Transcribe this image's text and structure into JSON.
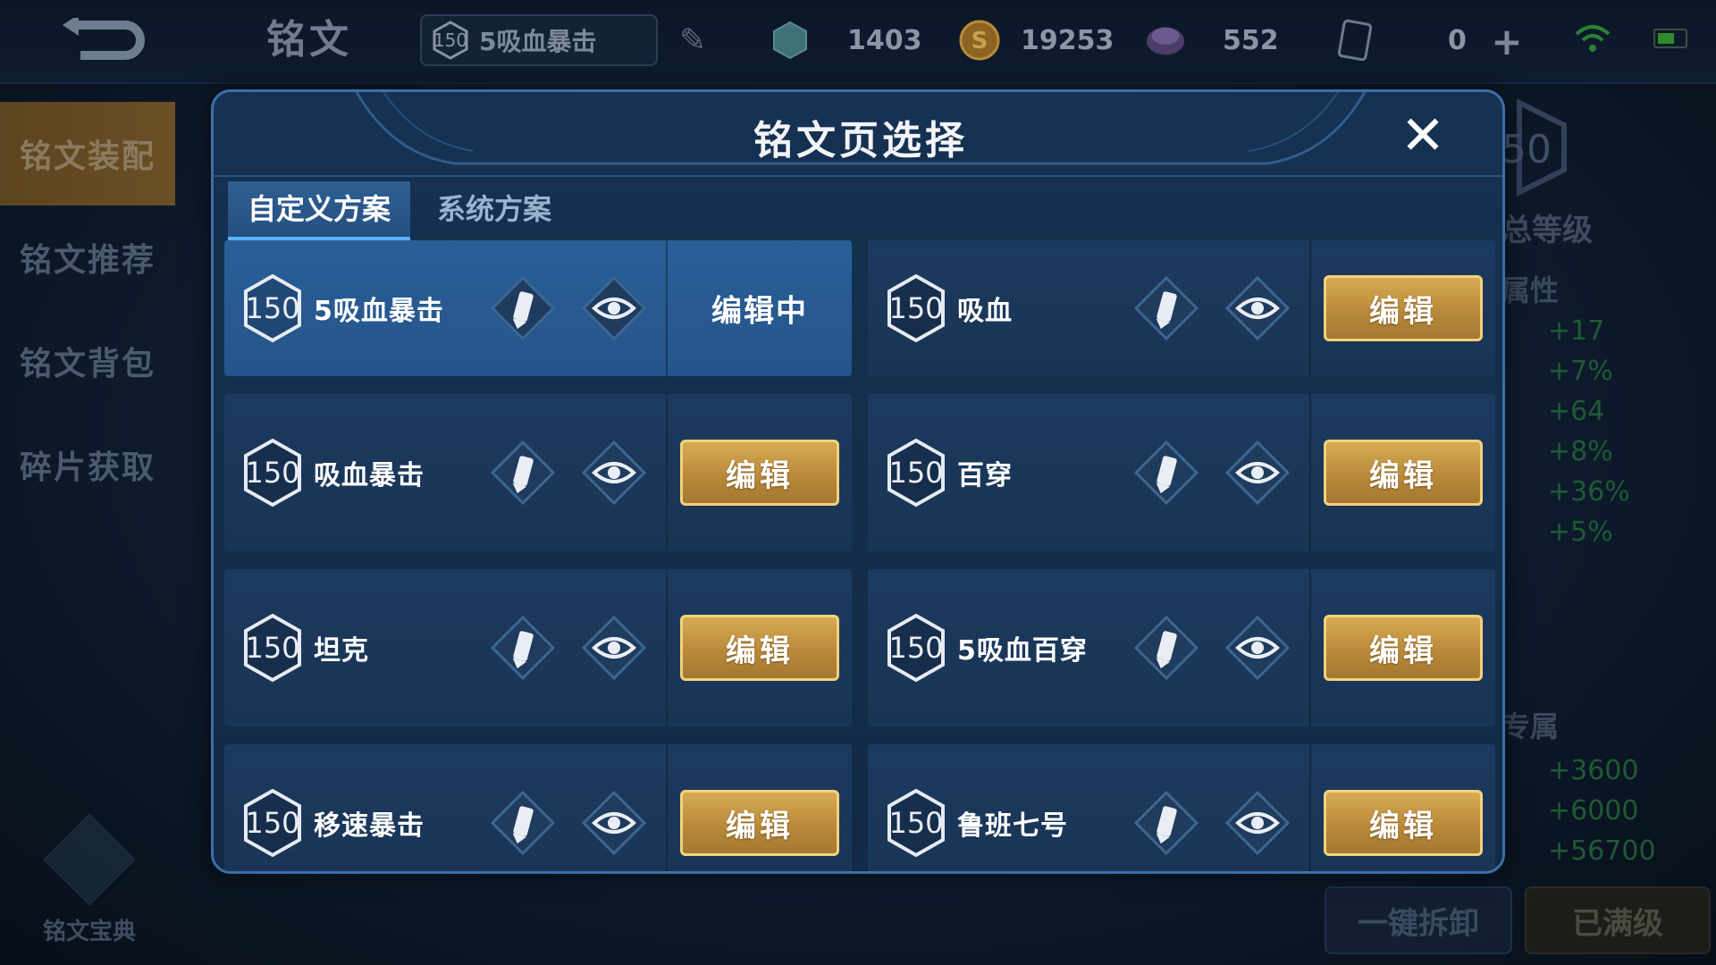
{
  "topbar": {
    "title": "铭文",
    "current_page": {
      "level": "150",
      "name": "5吸血暴击"
    },
    "resources": [
      {
        "icon": "crystal-icon",
        "value": "1403"
      },
      {
        "icon": "gold-coin-icon",
        "value": "19253"
      },
      {
        "icon": "gem-icon",
        "value": "552"
      },
      {
        "icon": "card-icon",
        "value": "0"
      }
    ]
  },
  "sidebar": {
    "items": [
      {
        "label": "铭文装配",
        "active": true
      },
      {
        "label": "铭文推荐",
        "active": false
      },
      {
        "label": "铭文背包",
        "active": false
      },
      {
        "label": "碎片获取",
        "active": false
      }
    ],
    "codex_label": "铭文宝典"
  },
  "right_panel": {
    "total_level_partial": "50",
    "total_label": "总等级",
    "attr_label": "属性",
    "attr_values": [
      "+17",
      "+7%",
      "+64",
      "+8%",
      "+36%",
      "+5%"
    ],
    "exclusive_label": "专属",
    "exclusive_values": [
      "+3600",
      "+6000",
      "+56700"
    ],
    "dismantle_label": "一键拆卸",
    "maxed_label": "已满级"
  },
  "modal": {
    "title": "铭文页选择",
    "tabs": [
      {
        "label": "自定义方案",
        "active": true
      },
      {
        "label": "系统方案",
        "active": false
      }
    ],
    "edit_label": "编辑",
    "editing_label": "编辑中",
    "pages": [
      {
        "level": "150",
        "name": "5吸血暴击",
        "editing": true
      },
      {
        "level": "150",
        "name": "吸血",
        "editing": false
      },
      {
        "level": "150",
        "name": "吸血暴击",
        "editing": false
      },
      {
        "level": "150",
        "name": "百穿",
        "editing": false
      },
      {
        "level": "150",
        "name": "坦克",
        "editing": false
      },
      {
        "level": "150",
        "name": "5吸血百穿",
        "editing": false
      },
      {
        "level": "150",
        "name": "移速暴击",
        "editing": false
      },
      {
        "level": "150",
        "name": "鲁班七号",
        "editing": false
      }
    ]
  },
  "colors": {
    "accent_gold": "#d7ab56",
    "modal_border": "#3b6fa6",
    "active_card": "#2a5f98",
    "attr_green": "#1f5a35"
  }
}
